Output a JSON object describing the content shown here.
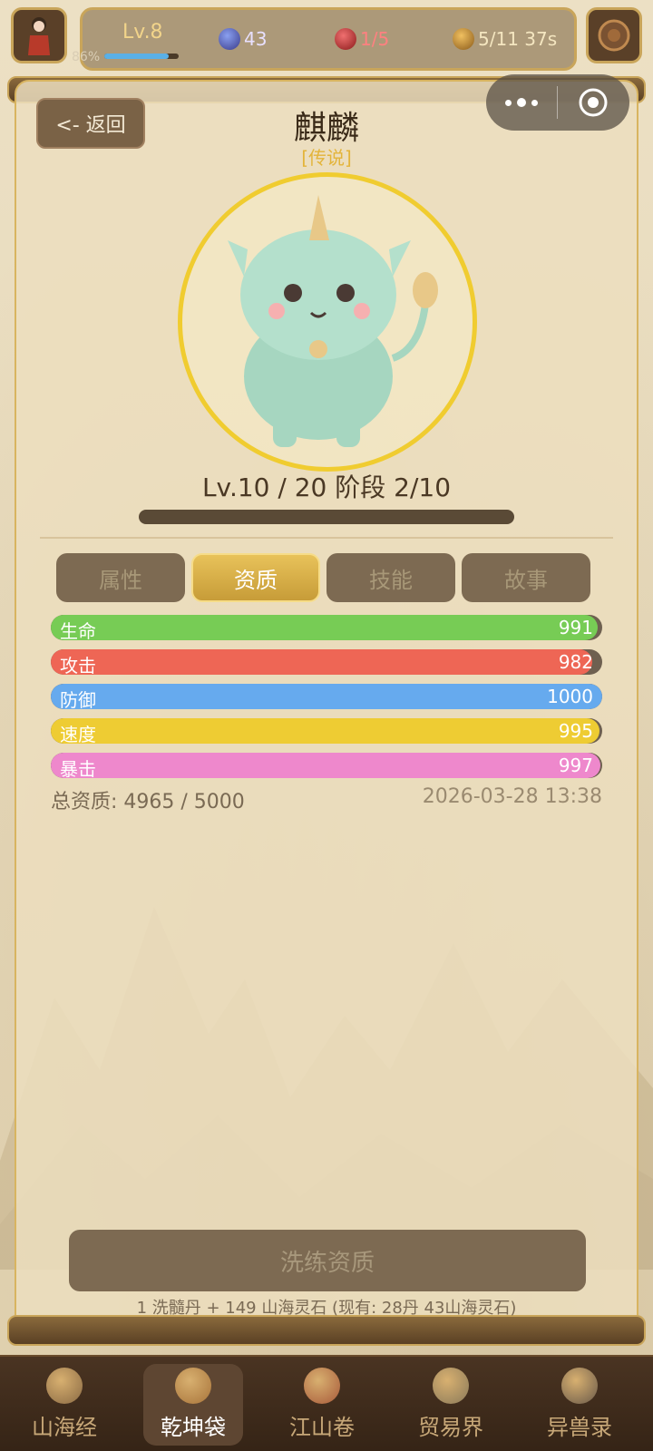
{
  "hud": {
    "level": "Lv.8",
    "exp_percent": "86%",
    "exp_fraction": 0.86,
    "gems": "43",
    "hearts": "1/5",
    "coins": "5/11 37s"
  },
  "header": {
    "back_label": "<- 返回",
    "title": "麒麟",
    "rarity": "[传说]"
  },
  "pet": {
    "level_line": "Lv.10 / 20  阶段 2/10",
    "exp_fraction": 0.0
  },
  "tabs": [
    {
      "label": "属性",
      "active": false
    },
    {
      "label": "资质",
      "active": true
    },
    {
      "label": "技能",
      "active": false
    },
    {
      "label": "故事",
      "active": false
    }
  ],
  "stats": [
    {
      "label": "生命",
      "value": "991",
      "fraction": 0.991,
      "color": "#77cc55"
    },
    {
      "label": "攻击",
      "value": "982",
      "fraction": 0.982,
      "color": "#ee6655"
    },
    {
      "label": "防御",
      "value": "1000",
      "fraction": 1.0,
      "color": "#66aaee"
    },
    {
      "label": "速度",
      "value": "995",
      "fraction": 0.995,
      "color": "#eecc33"
    },
    {
      "label": "暴击",
      "value": "997",
      "fraction": 0.997,
      "color": "#ee88cc"
    }
  ],
  "summary": {
    "total": "总资质: 4965 / 5000",
    "timestamp": "2026-03-28 13:38"
  },
  "refine": {
    "button_label": "洗练资质",
    "cost": "1 洗髓丹 + 149 山海灵石 (现有: 28丹 43山海灵石)"
  },
  "nav": [
    {
      "label": "山海经",
      "icon": "mountain-sea-icon",
      "active": false
    },
    {
      "label": "乾坤袋",
      "icon": "bag-icon",
      "active": true
    },
    {
      "label": "江山卷",
      "icon": "palace-icon",
      "active": false
    },
    {
      "label": "贸易界",
      "icon": "trade-icon",
      "active": false
    },
    {
      "label": "异兽录",
      "icon": "beast-icon",
      "active": false
    }
  ],
  "colors": {
    "accent": "#e3b43a",
    "panel_border": "#d8b460"
  }
}
